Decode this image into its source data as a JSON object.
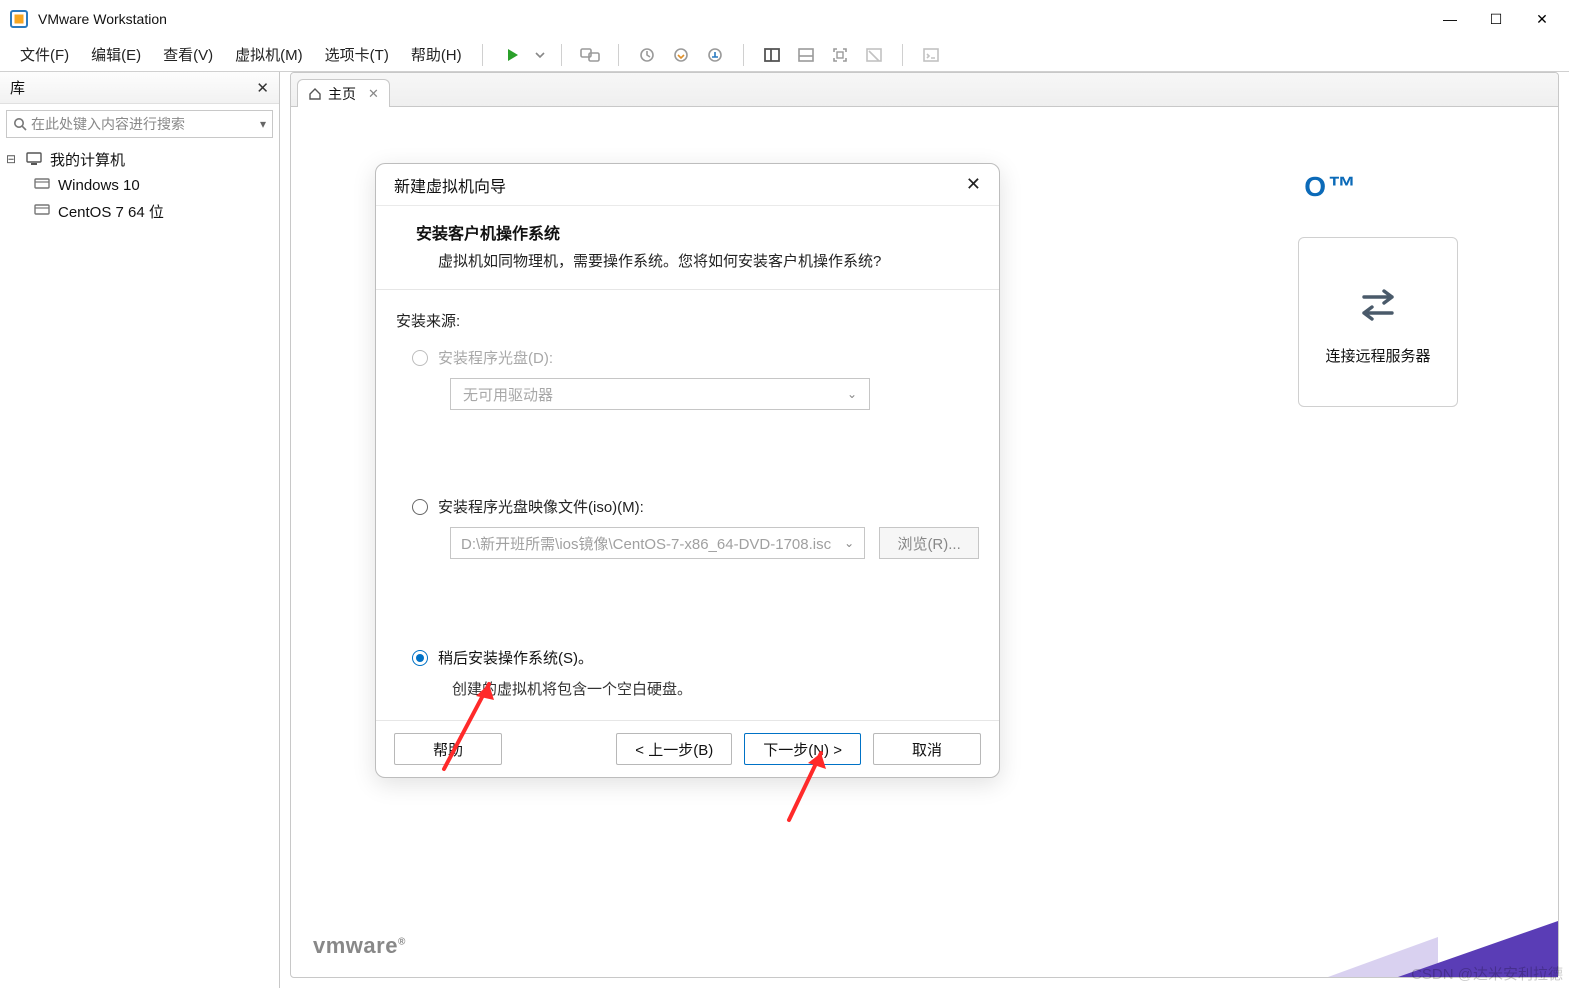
{
  "window": {
    "title": "VMware Workstation"
  },
  "menu": {
    "items": [
      "文件(F)",
      "编辑(E)",
      "查看(V)",
      "虚拟机(M)",
      "选项卡(T)",
      "帮助(H)"
    ]
  },
  "sidebar": {
    "title": "库",
    "search_placeholder": "在此处键入内容进行搜索",
    "root": "我的计算机",
    "items": [
      "Windows 10",
      "CentOS 7 64 位"
    ]
  },
  "tab": {
    "label": "主页"
  },
  "home": {
    "pro_brand": "O™",
    "quick_connect": "连接远程服务器",
    "vmware_logo": "vmware"
  },
  "dialog": {
    "title": "新建虚拟机向导",
    "header_title": "安装客户机操作系统",
    "header_sub": "虚拟机如同物理机，需要操作系统。您将如何安装客户机操作系统?",
    "source_label": "安装来源:",
    "opt_disc": "安装程序光盘(D):",
    "disc_combo": "无可用驱动器",
    "opt_iso": "安装程序光盘映像文件(iso)(M):",
    "iso_path": "D:\\新开班所需\\ios镜像\\CentOS-7-x86_64-DVD-1708.isc",
    "browse": "浏览(R)...",
    "opt_later": "稍后安装操作系统(S)。",
    "later_hint": "创建的虚拟机将包含一个空白硬盘。",
    "btn_help": "帮助",
    "btn_back": "< 上一步(B)",
    "btn_next": "下一步(N) >",
    "btn_cancel": "取消"
  },
  "watermark": "CSDN @达米安利拉德"
}
